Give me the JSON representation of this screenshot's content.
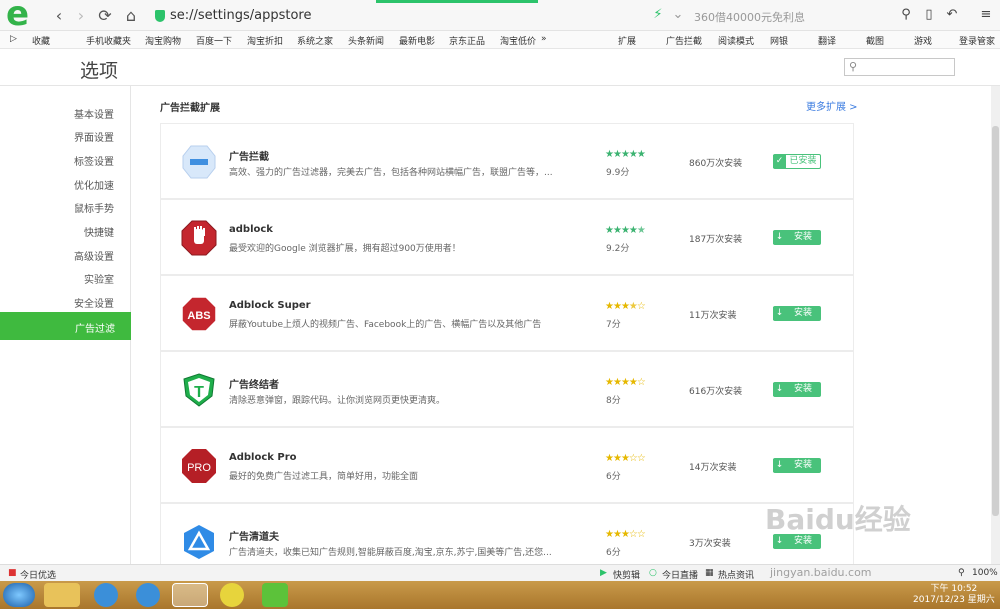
{
  "browser": {
    "url": "se://settings/appstore",
    "search_placeholder": "360借40000元免利息",
    "logo_letter": "e"
  },
  "bookmarks": {
    "left": [
      "收藏",
      "手机收藏夹",
      "淘宝购物",
      "百度一下",
      "淘宝折扣",
      "系统之家",
      "头条新闻",
      "最新电影",
      "京东正品",
      "淘宝低价"
    ],
    "overflow": "»",
    "right": [
      "扩展",
      "广告拦截",
      "阅读模式",
      "网银",
      "翻译",
      "截图",
      "游戏",
      "登录管家"
    ]
  },
  "settings": {
    "title": "选项",
    "search_placeholder": "",
    "sidebar": [
      "基本设置",
      "界面设置",
      "标签设置",
      "优化加速",
      "鼠标手势",
      "快捷键",
      "高级设置",
      "实验室",
      "安全设置",
      "广告过滤"
    ],
    "active": "广告过滤",
    "section_title": "广告拦截扩展",
    "more_link": "更多扩展 >"
  },
  "extensions": [
    {
      "name": "广告拦截",
      "desc": "高效、强力的广告过滤器，完美去广告，包括各种网站横幅广告，联盟广告等，...",
      "rating": 9.9,
      "score_label": "9.9分",
      "installs": "860万次安装",
      "button": "已安装",
      "installed": true,
      "star_color": "#3cb371",
      "icon": "minus-badge-icon"
    },
    {
      "name": "adblock",
      "desc": "最受欢迎的Google 浏览器扩展，拥有超过900万使用者！",
      "rating": 9.2,
      "score_label": "9.2分",
      "installs": "187万次安装",
      "button": "安装",
      "installed": false,
      "star_color": "#3cb371",
      "icon": "hand-stop-icon"
    },
    {
      "name": "Adblock Super",
      "desc": "屏蔽Youtube上烦人的视频广告、Facebook上的广告、横幅广告以及其他广告",
      "rating": 7,
      "score_label": "7分",
      "installs": "11万次安装",
      "button": "安装",
      "installed": false,
      "star_color": "#e6b800",
      "icon": "abs-octagon-icon"
    },
    {
      "name": "广告终结者",
      "desc": "清除恶意弹窗，跟踪代码。让你浏览网页更快更清爽。",
      "rating": 8,
      "score_label": "8分",
      "installs": "616万次安装",
      "button": "安装",
      "installed": false,
      "star_color": "#e6b800",
      "icon": "t-shield-icon"
    },
    {
      "name": "Adblock Pro",
      "desc": "最好的免费广告过滤工具，简单好用，功能全面",
      "rating": 6,
      "score_label": "6分",
      "installs": "14万次安装",
      "button": "安装",
      "installed": false,
      "star_color": "#e6b800",
      "icon": "pro-octagon-icon"
    },
    {
      "name": "广告清道夫",
      "desc": "广告清道夫，收集已知广告规则,智能屏蔽百度,淘宝,京东,苏宁,国美等广告,还您...",
      "rating": 6,
      "score_label": "6分",
      "installs": "3万次安装",
      "button": "安装",
      "installed": false,
      "star_color": "#e6b800",
      "icon": "triangle-badge-icon"
    }
  ],
  "statusbar": {
    "left": "今日优选",
    "items": [
      "快剪辑",
      "今日直播",
      "热点资讯"
    ],
    "zoom": "100%"
  },
  "taskbar": {
    "time": "10:52",
    "period": "下午",
    "date": "2017/12/23 星期六"
  },
  "watermark": {
    "text": "Baidu经验",
    "url": "jingyan.baidu.com"
  }
}
